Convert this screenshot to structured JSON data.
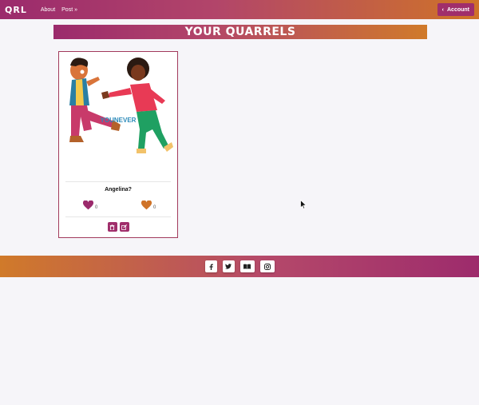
{
  "navbar": {
    "brand": "QRL",
    "links": [
      "About",
      "Post »"
    ],
    "account_label": "Account",
    "account_icon": "chevron-left-icon"
  },
  "page": {
    "title": "YOUR QUARRELS"
  },
  "card": {
    "title": "YOUNEVER",
    "subtitle": "Angelina?",
    "left_votes": "0",
    "right_votes": "0",
    "left_heart_color": "#9b2a6c",
    "right_heart_color": "#cf7328",
    "actions": [
      "trash-icon",
      "edit-icon"
    ]
  },
  "footer": {
    "social_icons": [
      "facebook-icon",
      "twitter-icon",
      "book-icon",
      "instagram-icon"
    ]
  },
  "colors": {
    "accent_magenta": "#9b2a6c",
    "accent_orange": "#cf7328",
    "title_blue": "#2b8ab9",
    "background": "#f6f5f9"
  }
}
